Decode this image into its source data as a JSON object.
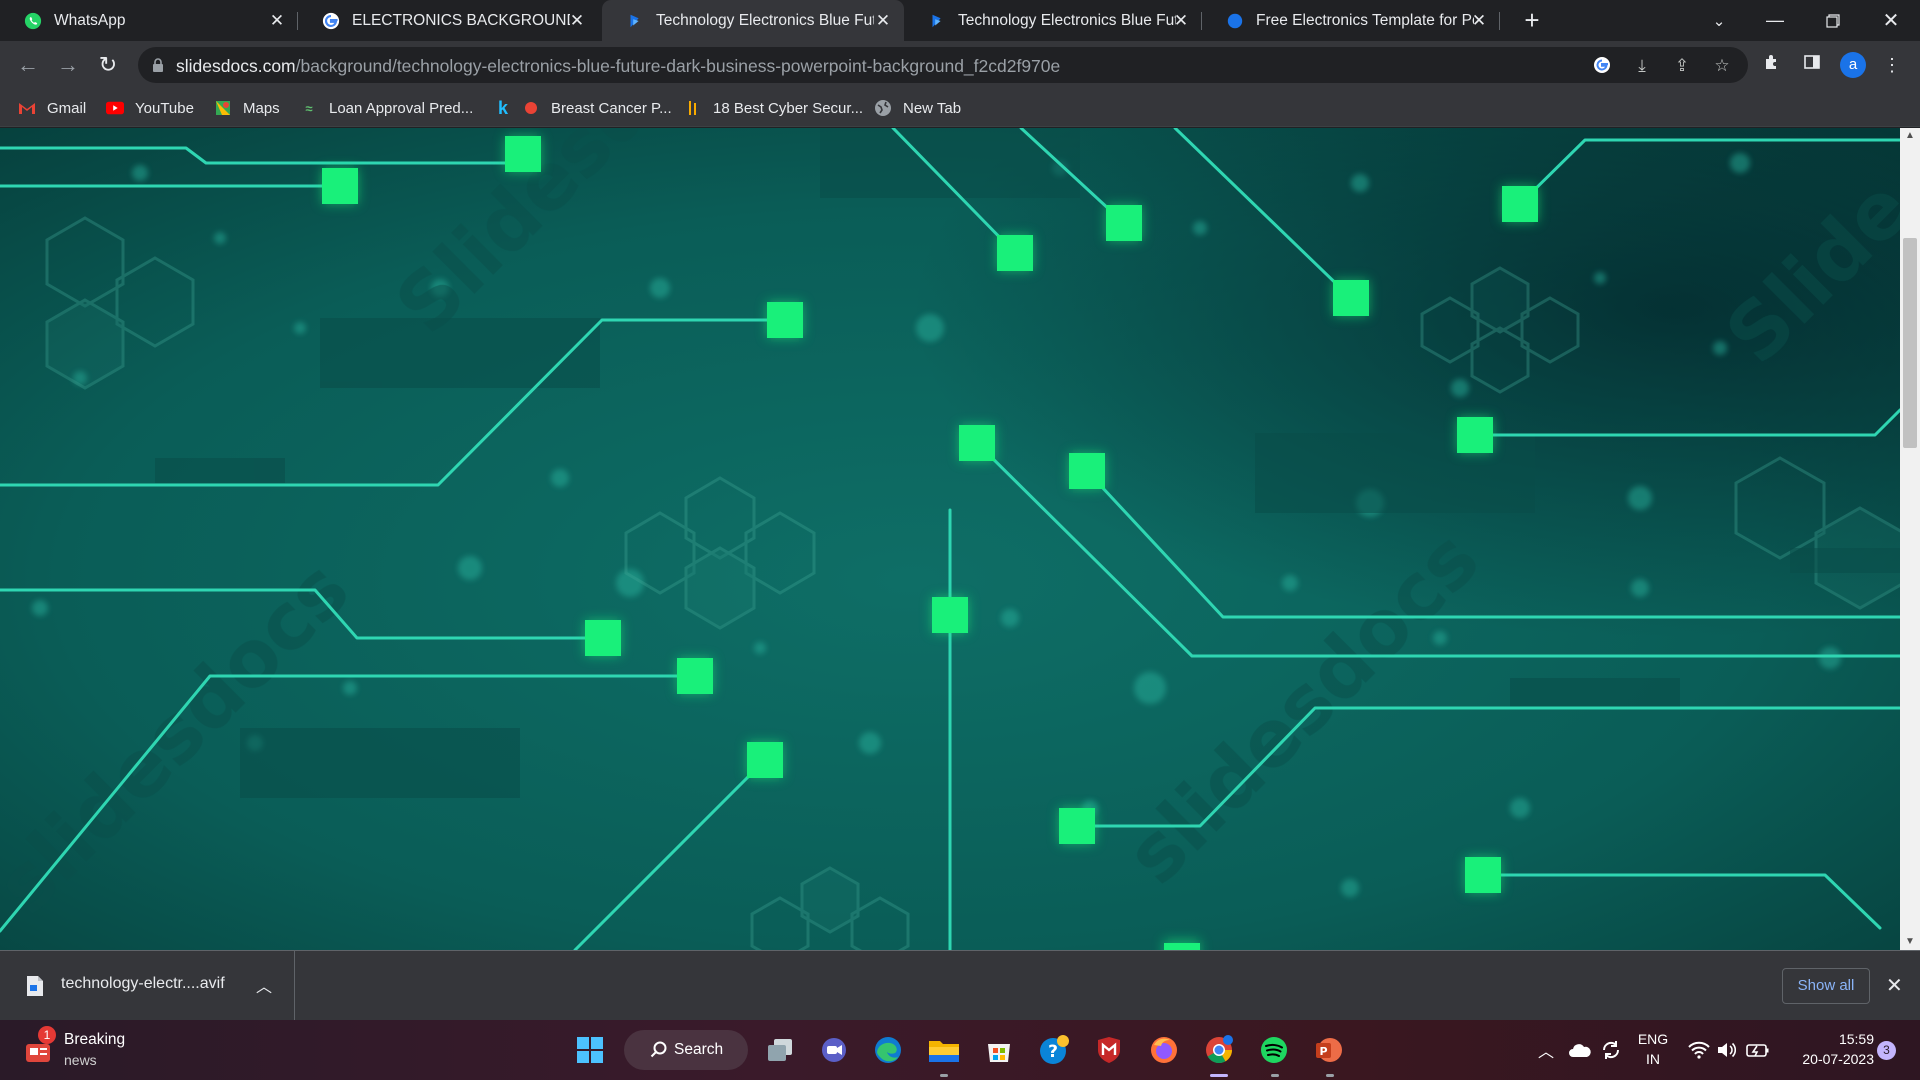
{
  "tabs": [
    {
      "title": "WhatsApp",
      "icon": "whatsapp-icon"
    },
    {
      "title": "ELECTRONICS BACKGROUND FO",
      "icon": "google-icon"
    },
    {
      "title": "Technology Electronics Blue Futu",
      "icon": "slidesdocs-icon"
    },
    {
      "title": "Technology Electronics Blue Futu",
      "icon": "slidesdocs-icon"
    },
    {
      "title": "Free Electronics Template for Pow",
      "icon": "blue-circle-icon"
    }
  ],
  "address": {
    "host": "slidesdocs.com",
    "path": "/background/technology-electronics-blue-future-dark-business-powerpoint-background_f2cd2f970e"
  },
  "bookmarks": [
    {
      "label": "Gmail",
      "icon": "gmail-icon"
    },
    {
      "label": "YouTube",
      "icon": "youtube-icon"
    },
    {
      "label": "Maps",
      "icon": "maps-icon"
    },
    {
      "label": "Loan Approval Pred...",
      "icon": "loan-icon"
    },
    {
      "label": "",
      "icon": "k-icon"
    },
    {
      "label": "Breast Cancer P...",
      "icon": "breast-cancer-icon"
    },
    {
      "label": "18 Best Cyber Secur...",
      "icon": "cyber-icon"
    },
    {
      "label": "New Tab",
      "icon": "globe-icon"
    }
  ],
  "profile": {
    "initial": "a"
  },
  "download": {
    "filename": "technology-electr....avif",
    "show_all": "Show all"
  },
  "taskbar": {
    "news_title": "Breaking",
    "news_sub": "news",
    "news_badge": "1",
    "search_label": "Search",
    "lang_top": "ENG",
    "lang_bottom": "IN",
    "time": "15:59",
    "date": "20-07-2023",
    "notif_count": "3"
  },
  "colors": {
    "background_teal": "#0b5a55",
    "circuit_line": "#2fd6b2",
    "node_green": "#19f07a",
    "chrome_dark": "#202124",
    "chrome_toolbar": "#35363a",
    "link_blue": "#8ab4f8"
  }
}
